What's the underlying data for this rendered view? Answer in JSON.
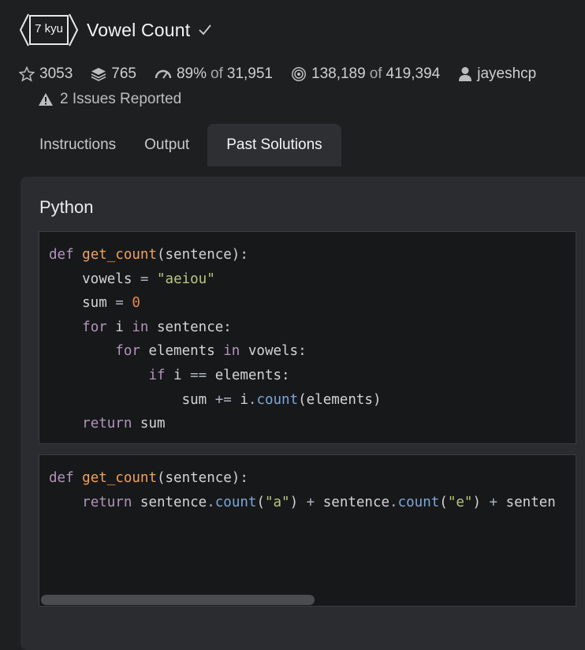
{
  "header": {
    "kyu": "7 kyu",
    "title": "Vowel Count"
  },
  "stats": {
    "stars": "3053",
    "collections": "765",
    "satisfaction_pct": "89%",
    "satisfaction_of": "of",
    "satisfaction_votes": "31,951",
    "completed": "138,189",
    "completed_of": "of",
    "attempts": "419,394",
    "author": "jayeshcp"
  },
  "issues": {
    "label": "2 Issues Reported"
  },
  "tabs": [
    {
      "label": "Instructions",
      "active": false
    },
    {
      "label": "Output",
      "active": false
    },
    {
      "label": "Past Solutions",
      "active": true
    }
  ],
  "language": "Python",
  "solutions": [
    {
      "lines": [
        "def get_count(sentence):",
        "    vowels = \"aeiou\"",
        "    sum = 0",
        "    for i in sentence:",
        "        for elements in vowels:",
        "            if i == elements:",
        "                sum += i.count(elements)",
        "    return sum"
      ]
    },
    {
      "lines": [
        "def get_count(sentence):",
        "    return sentence.count(\"a\") + sentence.count(\"e\") + senten"
      ]
    }
  ],
  "scrollbar": {
    "position": 0,
    "visible_fraction": 0.51
  },
  "colors": {
    "background": "#1e1f21",
    "panel": "#2a2c2f",
    "code_bg": "#17181a",
    "keyword": "#b294bb",
    "function": "#f0a25a",
    "string": "#b5c97f",
    "number": "#e58a55",
    "method": "#7aa8d8"
  },
  "icons": [
    "kyu-hex-badge",
    "checkmark-icon",
    "star-icon",
    "stack-icon",
    "gauge-icon",
    "target-icon",
    "user-icon",
    "warning-icon"
  ]
}
